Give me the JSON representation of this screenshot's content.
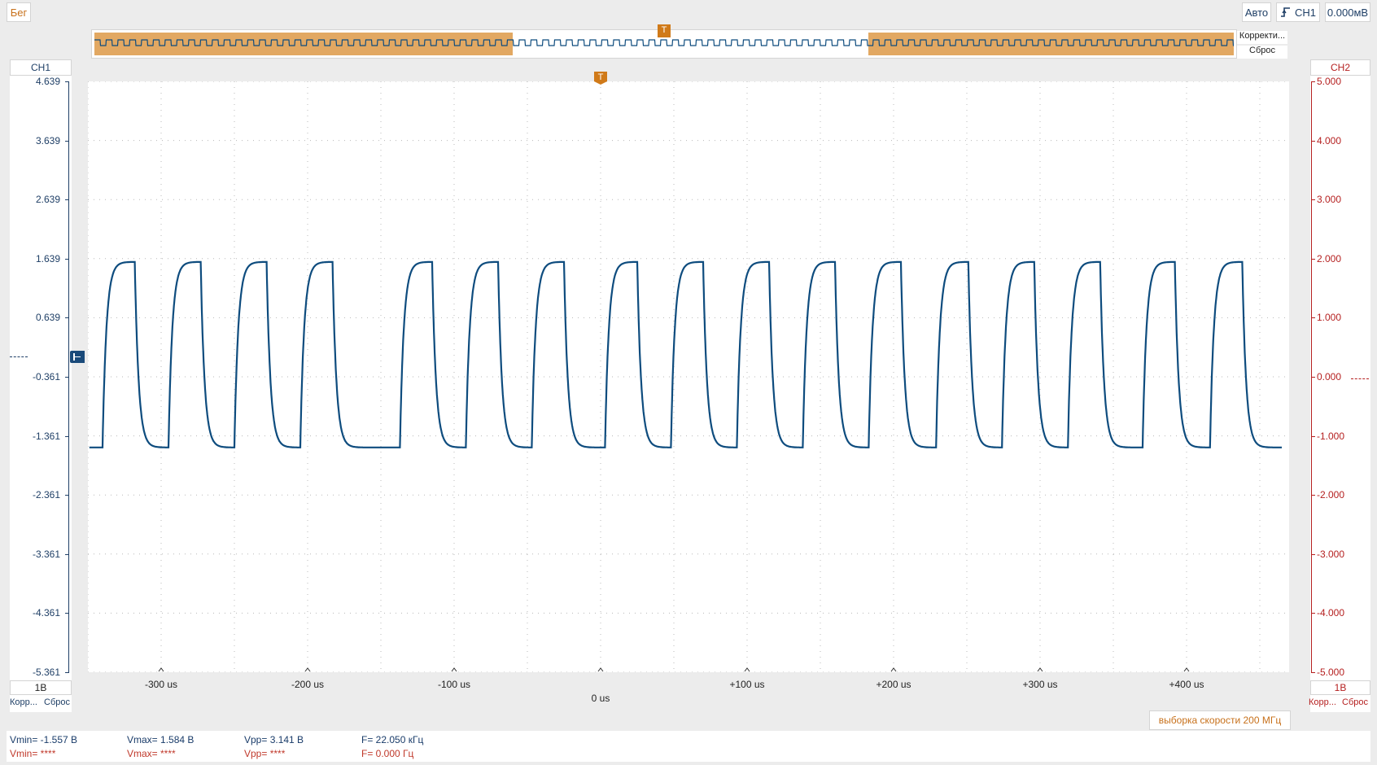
{
  "toolbar": {
    "run_state": "Бег",
    "trigger_mode": "Авто",
    "trigger_source": "CH1",
    "trigger_level": "0.000мВ"
  },
  "overview": {
    "auto_label": "Корректи...",
    "reset_label": "Сброс",
    "trigger_marker": "T"
  },
  "ch1": {
    "name": "CH1",
    "scale": "1В",
    "auto_label": "Корр...",
    "reset_label": "Сброс",
    "ticks": [
      "4.639",
      "3.639",
      "2.639",
      "1.639",
      "0.639",
      "-0.361",
      "-1.361",
      "-2.361",
      "-3.361",
      "-4.361",
      "-5.361"
    ],
    "color": "#0e4c7e"
  },
  "ch2": {
    "name": "CH2",
    "scale": "1В",
    "auto_label": "Корр...",
    "reset_label": "Сброс",
    "ticks": [
      "5.000",
      "4.000",
      "3.000",
      "2.000",
      "1.000",
      "0.000",
      "-1.000",
      "-2.000",
      "-3.000",
      "-4.000",
      "-5.000"
    ],
    "color": "#b52020"
  },
  "time_axis": {
    "labels": [
      "-300 us",
      "-200 us",
      "-100 us",
      "0 us",
      "+100 us",
      "+200 us",
      "+300 us",
      "+400 us"
    ],
    "center_label": "0 us"
  },
  "sample_rate": "выборка скорости 200 МГц",
  "measurements": {
    "ch1": {
      "vmin": "Vmin= -1.557 В",
      "vmax": "Vmax= 1.584 В",
      "vpp": "Vpp= 3.141 В",
      "freq": "F= 22.050 кГц"
    },
    "ch2": {
      "vmin": "Vmin= ****",
      "vmax": "Vmax= ****",
      "vpp": "Vpp= ****",
      "freq": "F= 0.000 Гц"
    }
  },
  "trigger_marker": "T",
  "chart_data": {
    "type": "line",
    "xlabel": "",
    "ylabel": "",
    "xlim": [
      -350,
      470
    ],
    "ylim": [
      -5.361,
      4.639
    ],
    "x_unit": "us",
    "grid": true,
    "series": [
      {
        "color": "#0e4c7e",
        "waveform": "square_wave_rc",
        "high_level": 1.584,
        "low_level": -1.557,
        "rising_edges_us": [
          -340,
          -295,
          -250,
          -205,
          -137,
          -92,
          -47,
          3,
          48,
          93,
          138,
          183,
          229,
          274,
          319,
          370,
          416
        ],
        "falling_edges_us": [
          -318,
          -273,
          -228,
          -183,
          -115,
          -70,
          -25,
          25,
          70,
          115,
          160,
          205,
          251,
          296,
          341,
          392,
          438
        ]
      }
    ]
  }
}
